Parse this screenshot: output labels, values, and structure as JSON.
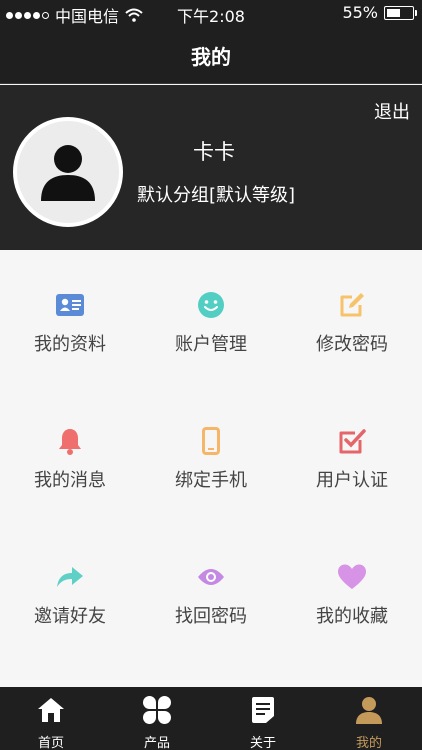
{
  "status_bar": {
    "carrier": "中国电信",
    "time": "下午2:08",
    "battery_percent": "55%",
    "battery_level": 0.55
  },
  "nav": {
    "title": "我的"
  },
  "profile": {
    "logout_label": "退出",
    "username": "卡卡",
    "group": "默认分组[默认等级]"
  },
  "grid": {
    "items": [
      {
        "label": "我的资料",
        "icon": "id-card-icon",
        "color": "#5b8bd6"
      },
      {
        "label": "账户管理",
        "icon": "smiley-icon",
        "color": "#52cfc2"
      },
      {
        "label": "修改密码",
        "icon": "edit-icon",
        "color": "#f6c36a"
      },
      {
        "label": "我的消息",
        "icon": "bell-icon",
        "color": "#ef6f6f"
      },
      {
        "label": "绑定手机",
        "icon": "phone-icon",
        "color": "#f6b66a"
      },
      {
        "label": "用户认证",
        "icon": "checkbox-icon",
        "color": "#e4666a"
      },
      {
        "label": "邀请好友",
        "icon": "share-icon",
        "color": "#5fd0c6"
      },
      {
        "label": "找回密码",
        "icon": "eye-icon",
        "color": "#c389e3"
      },
      {
        "label": "我的收藏",
        "icon": "heart-icon",
        "color": "#d793e6"
      }
    ]
  },
  "tabbar": {
    "items": [
      {
        "label": "首页",
        "icon": "home-icon"
      },
      {
        "label": "产品",
        "icon": "clover-icon"
      },
      {
        "label": "关于",
        "icon": "document-icon"
      },
      {
        "label": "我的",
        "icon": "user-icon",
        "active": true
      }
    ],
    "active_color": "#c49a5b"
  }
}
